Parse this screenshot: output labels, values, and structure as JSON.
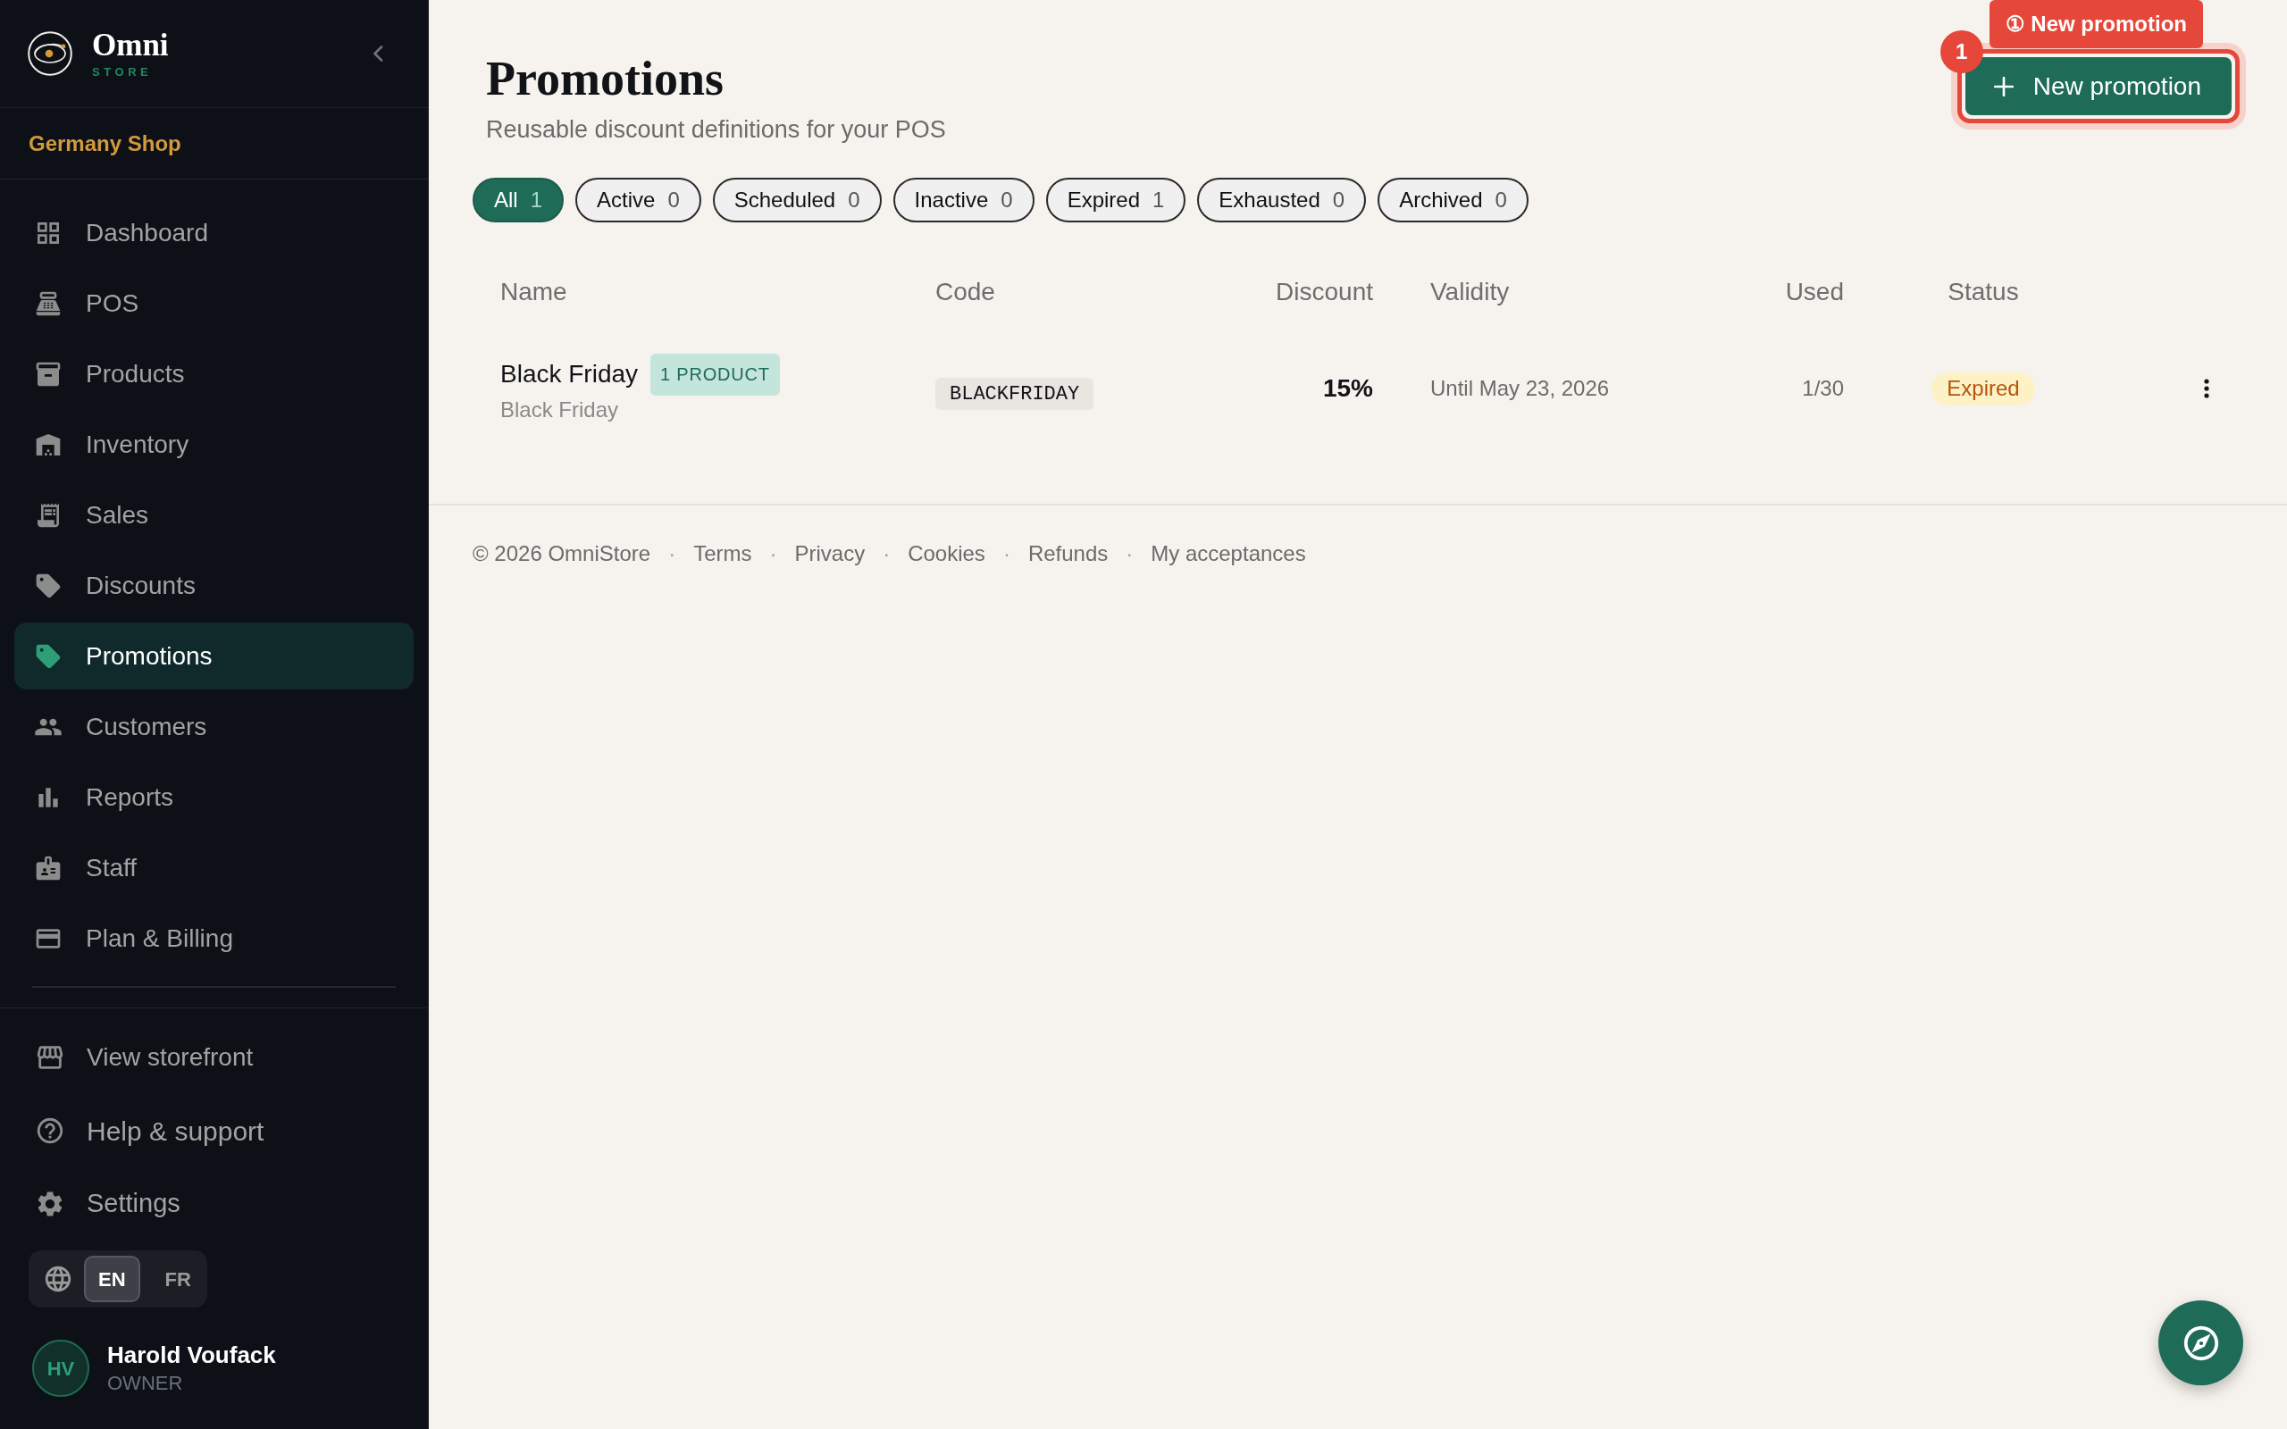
{
  "sidebar": {
    "brand": {
      "name": "Omni",
      "tagline": "STORE"
    },
    "shop": "Germany Shop",
    "nav": [
      {
        "label": "Dashboard",
        "selected": false
      },
      {
        "label": "POS",
        "selected": false
      },
      {
        "label": "Products",
        "selected": false
      },
      {
        "label": "Inventory",
        "selected": false
      },
      {
        "label": "Sales",
        "selected": false
      },
      {
        "label": "Discounts",
        "selected": false
      },
      {
        "label": "Promotions",
        "selected": true
      },
      {
        "label": "Customers",
        "selected": false
      },
      {
        "label": "Reports",
        "selected": false
      },
      {
        "label": "Staff",
        "selected": false
      },
      {
        "label": "Plan & Billing",
        "selected": false
      }
    ],
    "links": [
      "View storefront",
      "Help & support",
      "Settings"
    ],
    "languages": [
      {
        "label": "EN",
        "selected": true
      },
      {
        "label": "FR",
        "selected": false
      }
    ],
    "user": {
      "initials": "HV",
      "name": "Harold Voufack",
      "role": "OWNER"
    }
  },
  "header": {
    "title": "Promotions",
    "subtitle": "Reusable discount definitions for your POS",
    "action": "New promotion"
  },
  "annotation": {
    "label": "① New promotion",
    "step": "1"
  },
  "filters": [
    {
      "label": "All",
      "count": "1",
      "selected": true
    },
    {
      "label": "Active",
      "count": "0",
      "selected": false
    },
    {
      "label": "Scheduled",
      "count": "0",
      "selected": false
    },
    {
      "label": "Inactive",
      "count": "0",
      "selected": false
    },
    {
      "label": "Expired",
      "count": "1",
      "selected": false
    },
    {
      "label": "Exhausted",
      "count": "0",
      "selected": false
    },
    {
      "label": "Archived",
      "count": "0",
      "selected": false
    }
  ],
  "table": {
    "columns": [
      "Name",
      "Code",
      "Discount",
      "Validity",
      "Used",
      "Status"
    ],
    "rows": [
      {
        "name": "Black Friday",
        "tag": "1 PRODUCT",
        "description": "Black Friday",
        "code": "BLACKFRIDAY",
        "discount": "15%",
        "validity": "Until May 23, 2026",
        "used": "1/30",
        "status": "Expired"
      }
    ]
  },
  "footer": {
    "copyright": "© 2026 OmniStore",
    "links": [
      {
        "separator": "·",
        "label": "Terms"
      },
      {
        "separator": "·",
        "label": "Privacy"
      },
      {
        "separator": "·",
        "label": "Cookies"
      },
      {
        "separator": "·",
        "label": "Refunds"
      },
      {
        "separator": "·",
        "label": "My acceptances"
      }
    ]
  }
}
